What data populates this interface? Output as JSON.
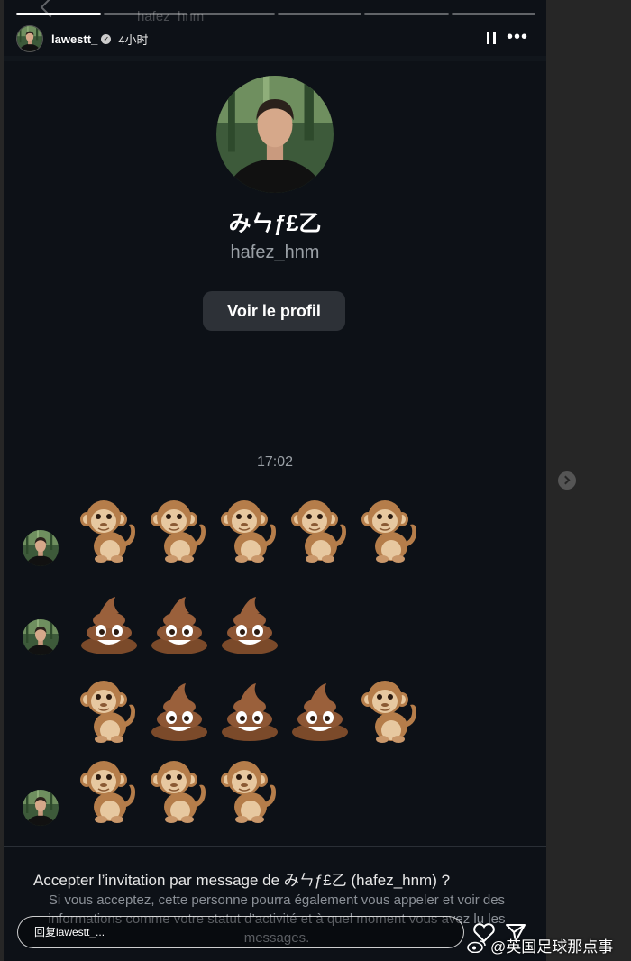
{
  "ghost_header": {
    "name": "hafez_hnm"
  },
  "progress": {
    "segments": 6,
    "current": 1
  },
  "header": {
    "username": "lawestt_",
    "time": "4小时"
  },
  "profile": {
    "display_name": "みㄣƒ£乙",
    "handle": "hafez_hnm",
    "button_label": "Voir le profil"
  },
  "conversation": {
    "timestamp": "17:02",
    "rows": [
      [
        "monkey",
        "monkey",
        "monkey",
        "monkey",
        "monkey"
      ],
      [
        "poop",
        "poop",
        "poop"
      ],
      [
        "monkey",
        "poop",
        "poop",
        "poop",
        "monkey"
      ],
      [
        "monkey",
        "monkey",
        "monkey"
      ]
    ]
  },
  "invitation": {
    "title": "Accepter l’invitation par message de みㄣƒ£乙 (hafez_hnm) ?",
    "description": "Si vous acceptez, cette personne pourra également vous appeler et voir des informations comme votre statut d’activité et à quel moment vous avez lu les messages."
  },
  "reply": {
    "placeholder": "回复lawestt_..."
  },
  "watermark": {
    "text": "@英国足球那点事"
  },
  "icons": {
    "verified": "verified-badge-icon",
    "pause": "pause-icon",
    "more": "more-options-icon",
    "like": "heart-icon",
    "send": "send-icon",
    "next": "chevron-right-icon",
    "weibo": "weibo-logo-icon"
  },
  "colors": {
    "story_bg": "#0d1117",
    "button_bg": "#2d3137",
    "muted_text": "#9aa0a6"
  }
}
